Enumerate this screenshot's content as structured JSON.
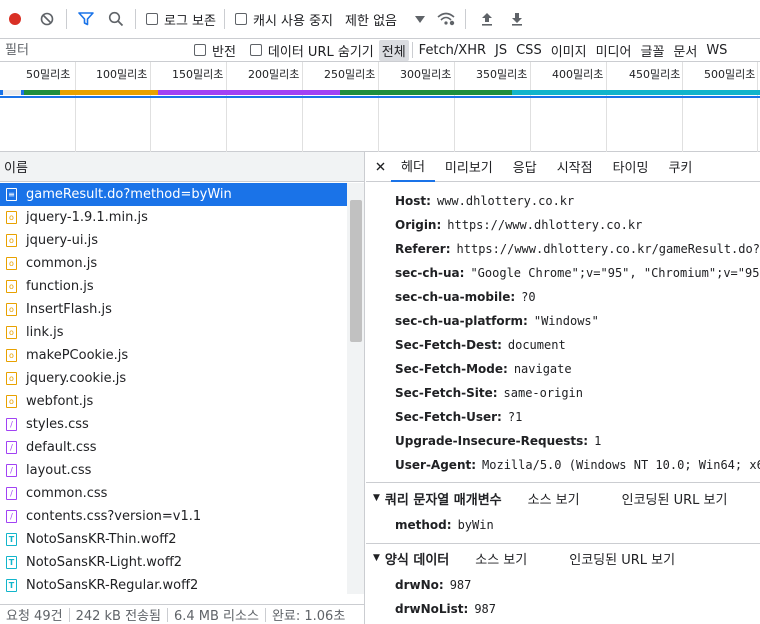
{
  "toolbar": {
    "preserve_log": "로그 보존",
    "disable_cache": "캐시 사용 중지",
    "throttle": "제한 없음"
  },
  "filterbar": {
    "placeholder": "필터",
    "invert": "반전",
    "hide_data_urls": "데이터 URL 숨기기",
    "types": [
      "전체",
      "Fetch/XHR",
      "JS",
      "CSS",
      "이미지",
      "미디어",
      "글꼴",
      "문서",
      "WS"
    ]
  },
  "timeline": {
    "ticks": [
      "50밀리초",
      "100밀리초",
      "150밀리초",
      "200밀리초",
      "250밀리초",
      "300밀리초",
      "350밀리초",
      "400밀리초",
      "450밀리초",
      "500밀리초"
    ]
  },
  "list": {
    "header": "이름",
    "rows": [
      {
        "name": "gameResult.do?method=byWin",
        "type": "doc"
      },
      {
        "name": "jquery-1.9.1.min.js",
        "type": "js"
      },
      {
        "name": "jquery-ui.js",
        "type": "js"
      },
      {
        "name": "common.js",
        "type": "js"
      },
      {
        "name": "function.js",
        "type": "js"
      },
      {
        "name": "InsertFlash.js",
        "type": "js"
      },
      {
        "name": "link.js",
        "type": "js"
      },
      {
        "name": "makePCookie.js",
        "type": "js"
      },
      {
        "name": "jquery.cookie.js",
        "type": "js"
      },
      {
        "name": "webfont.js",
        "type": "js"
      },
      {
        "name": "styles.css",
        "type": "css"
      },
      {
        "name": "default.css",
        "type": "css"
      },
      {
        "name": "layout.css",
        "type": "css"
      },
      {
        "name": "common.css",
        "type": "css"
      },
      {
        "name": "contents.css?version=v1.1",
        "type": "css"
      },
      {
        "name": "NotoSansKR-Thin.woff2",
        "type": "font"
      },
      {
        "name": "NotoSansKR-Light.woff2",
        "type": "font"
      },
      {
        "name": "NotoSansKR-Regular.woff2",
        "type": "font"
      }
    ]
  },
  "status": {
    "requests": "요청 49건",
    "transferred": "242 kB 전송됨",
    "resources": "6.4 MB 리소스",
    "finish": "완료: 1.06초"
  },
  "details": {
    "tabs": [
      "헤더",
      "미리보기",
      "응답",
      "시작점",
      "타이밍",
      "쿠키"
    ],
    "headers": [
      {
        "key": "Host:",
        "value": "www.dhlottery.co.kr"
      },
      {
        "key": "Origin:",
        "value": "https://www.dhlottery.co.kr"
      },
      {
        "key": "Referer:",
        "value": "https://www.dhlottery.co.kr/gameResult.do?m"
      },
      {
        "key": "sec-ch-ua:",
        "value": "\"Google Chrome\";v=\"95\", \"Chromium\";v=\"95\""
      },
      {
        "key": "sec-ch-ua-mobile:",
        "value": "?0"
      },
      {
        "key": "sec-ch-ua-platform:",
        "value": "\"Windows\""
      },
      {
        "key": "Sec-Fetch-Dest:",
        "value": "document"
      },
      {
        "key": "Sec-Fetch-Mode:",
        "value": "navigate"
      },
      {
        "key": "Sec-Fetch-Site:",
        "value": "same-origin"
      },
      {
        "key": "Sec-Fetch-User:",
        "value": "?1"
      },
      {
        "key": "Upgrade-Insecure-Requests:",
        "value": "1"
      },
      {
        "key": "User-Agent:",
        "value": "Mozilla/5.0 (Windows NT 10.0; Win64; x64"
      }
    ],
    "query_section": {
      "title": "쿼리 문자열 매개변수",
      "view_source": "소스 보기",
      "view_encoded": "인코딩된 URL 보기",
      "params": [
        {
          "key": "method:",
          "value": "byWin"
        }
      ]
    },
    "form_section": {
      "title": "양식 데이터",
      "view_source": "소스 보기",
      "view_encoded": "인코딩된 URL 보기",
      "params": [
        {
          "key": "drwNo:",
          "value": "987"
        },
        {
          "key": "drwNoList:",
          "value": "987"
        }
      ]
    }
  }
}
